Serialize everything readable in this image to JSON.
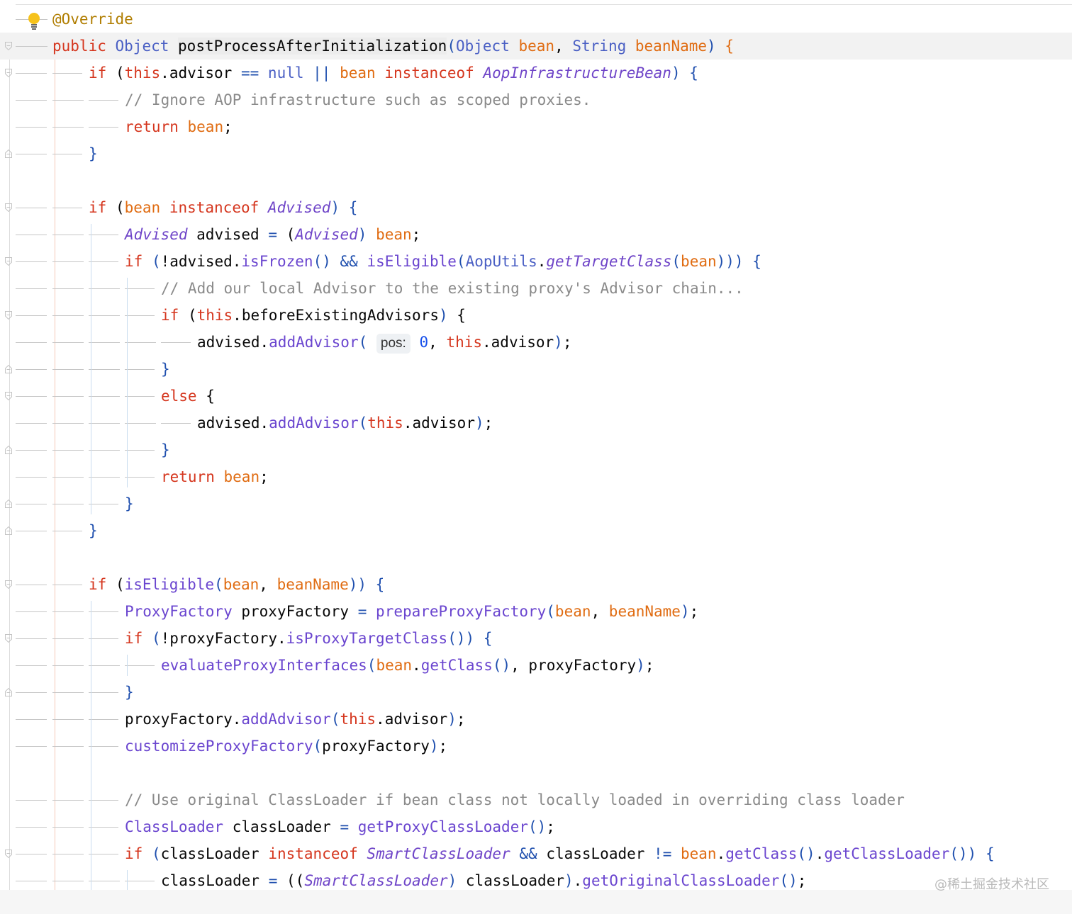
{
  "editor": {
    "lines": [
      [
        [
          "a",
          "@Override"
        ]
      ],
      [
        [
          "k",
          "public"
        ],
        [
          "d",
          " "
        ],
        [
          "t",
          "Object"
        ],
        [
          "d",
          " "
        ],
        [
          "mh",
          "postProcessAfterInitialization"
        ],
        [
          "b",
          "("
        ],
        [
          "t",
          "Object"
        ],
        [
          "d",
          " "
        ],
        [
          "p",
          "bean"
        ],
        [
          "d",
          ", "
        ],
        [
          "t",
          "String"
        ],
        [
          "d",
          " "
        ],
        [
          "p",
          "beanName"
        ],
        [
          "b",
          ")"
        ],
        [
          "d",
          " "
        ],
        [
          "p",
          "{"
        ]
      ],
      [
        [
          "k",
          "if"
        ],
        [
          "d",
          " ("
        ],
        [
          "k",
          "this"
        ],
        [
          "d",
          ".advisor "
        ],
        [
          "b",
          "=="
        ],
        [
          "d",
          " "
        ],
        [
          "t",
          "null"
        ],
        [
          "d",
          " "
        ],
        [
          "b",
          "||"
        ],
        [
          "d",
          " "
        ],
        [
          "p",
          "bean"
        ],
        [
          "d",
          " "
        ],
        [
          "k",
          "instanceof"
        ],
        [
          "d",
          " "
        ],
        [
          "i",
          "AopInfrastructureBean"
        ],
        [
          "b",
          ")"
        ],
        [
          "d",
          " "
        ],
        [
          "b",
          "{"
        ]
      ],
      [
        [
          "c",
          "// Ignore AOP infrastructure such as scoped proxies."
        ]
      ],
      [
        [
          "k",
          "return"
        ],
        [
          "d",
          " "
        ],
        [
          "p",
          "bean"
        ],
        [
          "d",
          ";"
        ]
      ],
      [
        [
          "b",
          "}"
        ]
      ],
      [],
      [
        [
          "k",
          "if"
        ],
        [
          "d",
          " ("
        ],
        [
          "p",
          "bean"
        ],
        [
          "d",
          " "
        ],
        [
          "k",
          "instanceof"
        ],
        [
          "d",
          " "
        ],
        [
          "i",
          "Advised"
        ],
        [
          "b",
          ")"
        ],
        [
          "d",
          " "
        ],
        [
          "b",
          "{"
        ]
      ],
      [
        [
          "i",
          "Advised"
        ],
        [
          "d",
          " advised "
        ],
        [
          "b",
          "="
        ],
        [
          "d",
          " ("
        ],
        [
          "i",
          "Advised"
        ],
        [
          "b",
          ")"
        ],
        [
          "d",
          " "
        ],
        [
          "p",
          "bean"
        ],
        [
          "d",
          ";"
        ]
      ],
      [
        [
          "k",
          "if"
        ],
        [
          "d",
          " "
        ],
        [
          "b",
          "("
        ],
        [
          "d",
          "!advised."
        ],
        [
          "m",
          "isFrozen"
        ],
        [
          "b",
          "()"
        ],
        [
          "d",
          " "
        ],
        [
          "b",
          "&&"
        ],
        [
          "d",
          " "
        ],
        [
          "m",
          "isEligible"
        ],
        [
          "b",
          "("
        ],
        [
          "t",
          "AopUtils"
        ],
        [
          "d",
          "."
        ],
        [
          "i",
          "getTargetClass"
        ],
        [
          "b",
          "("
        ],
        [
          "p",
          "bean"
        ],
        [
          "b",
          ")))"
        ],
        [
          "d",
          " "
        ],
        [
          "b",
          "{"
        ]
      ],
      [
        [
          "c",
          "// Add our local Advisor to the existing proxy's Advisor chain..."
        ]
      ],
      [
        [
          "k",
          "if"
        ],
        [
          "d",
          " ("
        ],
        [
          "k",
          "this"
        ],
        [
          "d",
          ".beforeExistingAdvisors"
        ],
        [
          "b",
          ")"
        ],
        [
          "d",
          " {"
        ]
      ],
      [
        [
          "d",
          "advised."
        ],
        [
          "m",
          "addAdvisor"
        ],
        [
          "b",
          "("
        ],
        [
          "d",
          " "
        ],
        [
          "hint",
          "pos:"
        ],
        [
          "d",
          " "
        ],
        [
          "n",
          "0"
        ],
        [
          "d",
          ", "
        ],
        [
          "k",
          "this"
        ],
        [
          "d",
          ".advisor"
        ],
        [
          "b",
          ")"
        ],
        [
          "d",
          ";"
        ]
      ],
      [
        [
          "b",
          "}"
        ]
      ],
      [
        [
          "k",
          "else"
        ],
        [
          "d",
          " {"
        ]
      ],
      [
        [
          "d",
          "advised."
        ],
        [
          "m",
          "addAdvisor"
        ],
        [
          "b",
          "("
        ],
        [
          "k",
          "this"
        ],
        [
          "d",
          ".advisor"
        ],
        [
          "b",
          ")"
        ],
        [
          "d",
          ";"
        ]
      ],
      [
        [
          "b",
          "}"
        ]
      ],
      [
        [
          "k",
          "return"
        ],
        [
          "d",
          " "
        ],
        [
          "p",
          "bean"
        ],
        [
          "d",
          ";"
        ]
      ],
      [
        [
          "b",
          "}"
        ]
      ],
      [
        [
          "b",
          "}"
        ]
      ],
      [],
      [
        [
          "k",
          "if"
        ],
        [
          "d",
          " ("
        ],
        [
          "m",
          "isEligible"
        ],
        [
          "b",
          "("
        ],
        [
          "p",
          "bean"
        ],
        [
          "d",
          ", "
        ],
        [
          "p",
          "beanName"
        ],
        [
          "b",
          "))"
        ],
        [
          "d",
          " "
        ],
        [
          "b",
          "{"
        ]
      ],
      [
        [
          "m",
          "ProxyFactory"
        ],
        [
          "d",
          " proxyFactory "
        ],
        [
          "b",
          "="
        ],
        [
          "d",
          " "
        ],
        [
          "m",
          "prepareProxyFactory"
        ],
        [
          "b",
          "("
        ],
        [
          "p",
          "bean"
        ],
        [
          "d",
          ", "
        ],
        [
          "p",
          "beanName"
        ],
        [
          "b",
          ")"
        ],
        [
          "d",
          ";"
        ]
      ],
      [
        [
          "k",
          "if"
        ],
        [
          "d",
          " "
        ],
        [
          "b",
          "("
        ],
        [
          "d",
          "!proxyFactory."
        ],
        [
          "m",
          "isProxyTargetClass"
        ],
        [
          "b",
          "())"
        ],
        [
          "d",
          " "
        ],
        [
          "b",
          "{"
        ]
      ],
      [
        [
          "m",
          "evaluateProxyInterfaces"
        ],
        [
          "b",
          "("
        ],
        [
          "p",
          "bean"
        ],
        [
          "d",
          "."
        ],
        [
          "m",
          "getClass"
        ],
        [
          "b",
          "()"
        ],
        [
          "d",
          ", proxyFactory"
        ],
        [
          "b",
          ")"
        ],
        [
          "d",
          ";"
        ]
      ],
      [
        [
          "b",
          "}"
        ]
      ],
      [
        [
          "d",
          "proxyFactory."
        ],
        [
          "m",
          "addAdvisor"
        ],
        [
          "b",
          "("
        ],
        [
          "k",
          "this"
        ],
        [
          "d",
          ".advisor"
        ],
        [
          "b",
          ")"
        ],
        [
          "d",
          ";"
        ]
      ],
      [
        [
          "m",
          "customizeProxyFactory"
        ],
        [
          "b",
          "("
        ],
        [
          "d",
          "proxyFactory"
        ],
        [
          "b",
          ")"
        ],
        [
          "d",
          ";"
        ]
      ],
      [],
      [
        [
          "c",
          "// Use original ClassLoader if bean class not locally loaded in overriding class loader"
        ]
      ],
      [
        [
          "m",
          "ClassLoader"
        ],
        [
          "d",
          " classLoader "
        ],
        [
          "b",
          "="
        ],
        [
          "d",
          " "
        ],
        [
          "m",
          "getProxyClassLoader"
        ],
        [
          "b",
          "()"
        ],
        [
          "d",
          ";"
        ]
      ],
      [
        [
          "k",
          "if"
        ],
        [
          "d",
          " "
        ],
        [
          "b",
          "("
        ],
        [
          "d",
          "classLoader "
        ],
        [
          "k",
          "instanceof"
        ],
        [
          "d",
          " "
        ],
        [
          "i",
          "SmartClassLoader"
        ],
        [
          "d",
          " "
        ],
        [
          "b",
          "&&"
        ],
        [
          "d",
          " classLoader "
        ],
        [
          "b",
          "!="
        ],
        [
          "d",
          " "
        ],
        [
          "p",
          "bean"
        ],
        [
          "d",
          "."
        ],
        [
          "m",
          "getClass"
        ],
        [
          "b",
          "()"
        ],
        [
          "d",
          "."
        ],
        [
          "m",
          "getClassLoader"
        ],
        [
          "b",
          "())"
        ],
        [
          "d",
          " "
        ],
        [
          "b",
          "{"
        ]
      ],
      [
        [
          "d",
          "classLoader "
        ],
        [
          "b",
          "="
        ],
        [
          "d",
          " (("
        ],
        [
          "i",
          "SmartClassLoader"
        ],
        [
          "b",
          ")"
        ],
        [
          "d",
          " classLoader"
        ],
        [
          "b",
          ")"
        ],
        [
          "d",
          "."
        ],
        [
          "m",
          "getOriginalClassLoader"
        ],
        [
          "b",
          "()"
        ],
        [
          "d",
          ";"
        ]
      ]
    ],
    "watermark": "@稀土掘金技术社区"
  }
}
